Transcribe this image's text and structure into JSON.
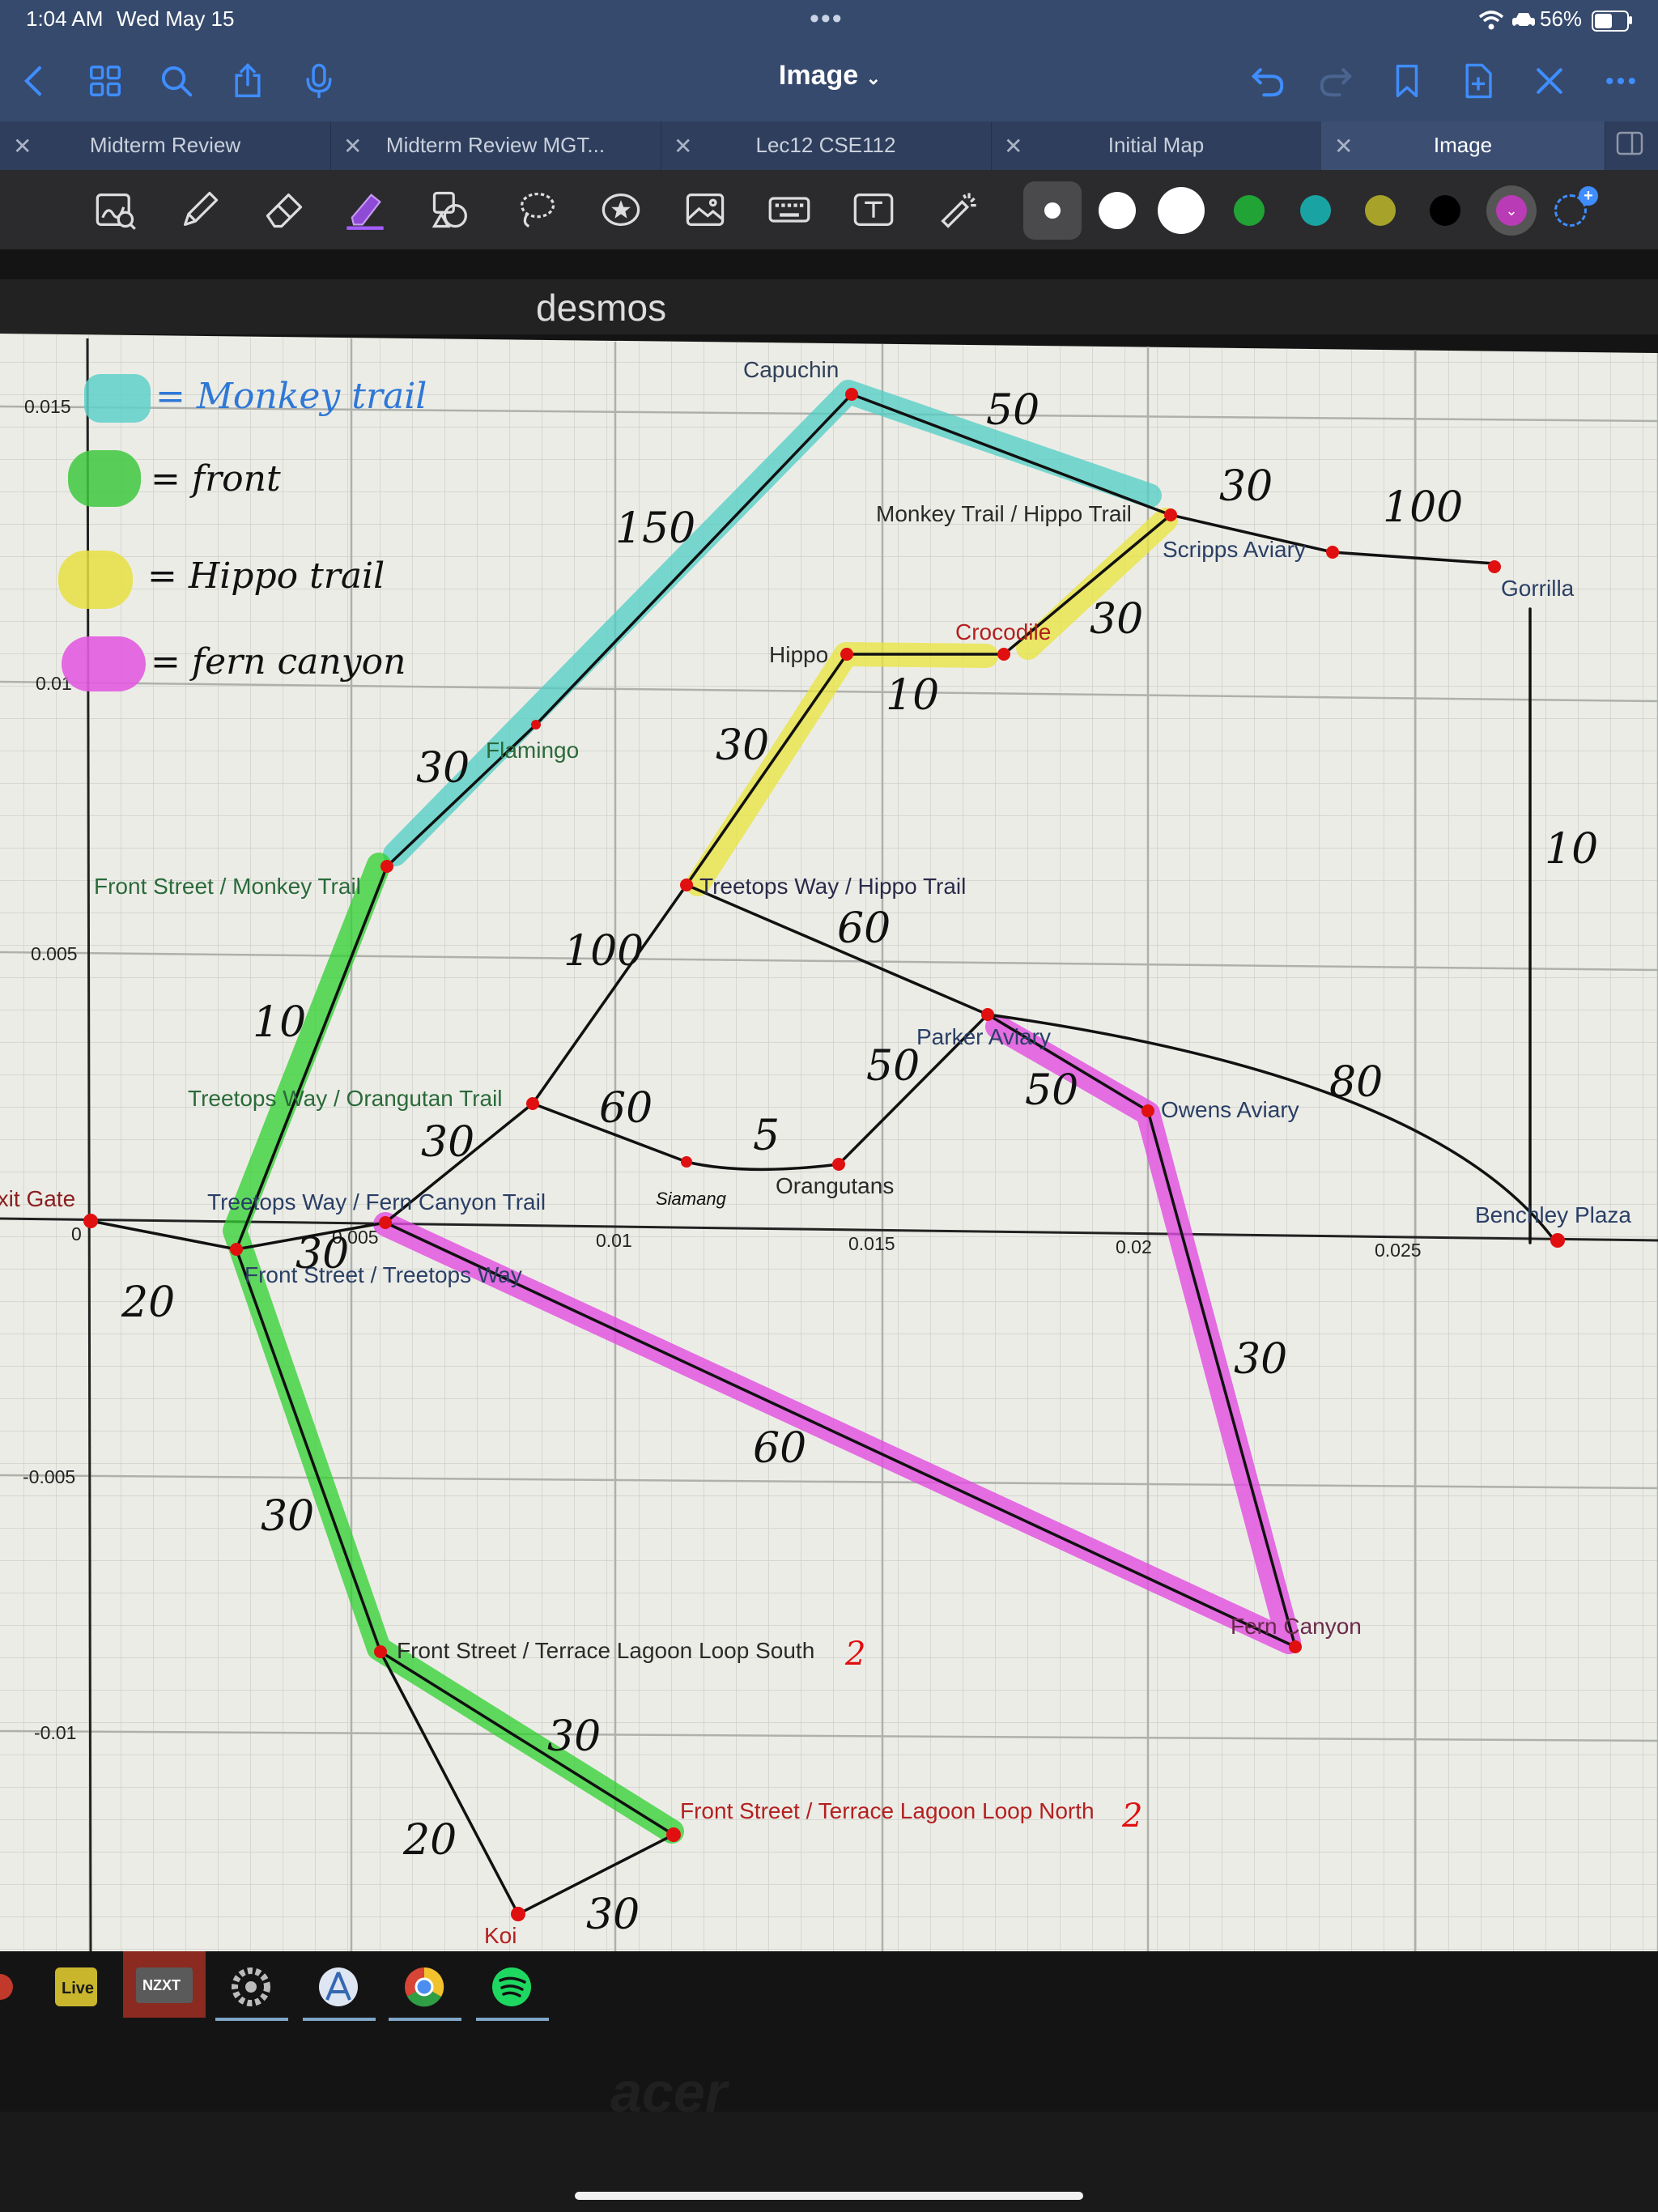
{
  "status_bar": {
    "time": "1:04 AM",
    "date": "Wed May 15",
    "battery": "56%",
    "battery_level": 0.56
  },
  "toolbar": {
    "title": "Image",
    "left_icons": [
      "back-icon",
      "grid-icon",
      "search-icon",
      "share-icon",
      "microphone-icon"
    ],
    "right_icons": [
      "undo-icon",
      "redo-icon",
      "bookmark-icon",
      "add-page-icon",
      "close-icon",
      "more-icon"
    ]
  },
  "tabs": [
    {
      "label": "Midterm Review",
      "active": false
    },
    {
      "label": "Midterm Review MGT...",
      "active": false
    },
    {
      "label": "Lec12 CSE112",
      "active": false
    },
    {
      "label": "Initial Map",
      "active": false
    },
    {
      "label": "Image",
      "active": true
    }
  ],
  "pen_toolbar": {
    "tools": [
      "zoom-box-icon",
      "pen-icon",
      "eraser-icon",
      "highlighter-icon",
      "shapes-icon",
      "lasso-icon",
      "sticker-icon",
      "image-icon",
      "keyboard-icon",
      "text-icon",
      "laser-pointer-icon"
    ],
    "colors": [
      "#ffffff",
      "#ffffff",
      "#ffffff",
      "#21a336",
      "#1aa3a3",
      "#a7a22a",
      "#000000",
      "#b93bb5"
    ],
    "selected_color": "#b93bb5"
  },
  "photo": {
    "app_logo": "desmos",
    "monitor_brand": "acer",
    "taskbar": [
      "Live",
      "NZXT"
    ],
    "legend": [
      {
        "color": "#5fd0c9",
        "text": "= Monkey trail"
      },
      {
        "color": "#3ec93e",
        "text": "= front"
      },
      {
        "color": "#e6e040",
        "text": "= Hippo trail"
      },
      {
        "color": "#e35ce0",
        "text": "= fern canyon"
      }
    ],
    "x_ticks": [
      "0",
      "0.005",
      "0.01",
      "0.015",
      "0.02",
      "0.025"
    ],
    "y_ticks": [
      "0.015",
      "0.01",
      "0.005",
      "0",
      "-0.005",
      "-0.01"
    ],
    "points": [
      {
        "label": "Capuchin",
        "x": 0.0146,
        "y": 0.0155
      },
      {
        "label": "Monkey Trail / Hippo Trail",
        "x": 0.0206,
        "y": 0.0135
      },
      {
        "label": "Scripps Aviary",
        "x": 0.0236,
        "y": 0.013
      },
      {
        "label": "Gorrilla",
        "x": 0.0267,
        "y": 0.0125
      },
      {
        "label": "Hippo",
        "x": 0.0146,
        "y": 0.0105
      },
      {
        "label": "Crocodile",
        "x": 0.0176,
        "y": 0.0105
      },
      {
        "label": "Flamingo",
        "x": 0.0085,
        "y": 0.0093
      },
      {
        "label": "Front Street / Monkey Trail",
        "x": 0.0057,
        "y": 0.0068
      },
      {
        "label": "Treetops Way / Hippo Trail",
        "x": 0.0115,
        "y": 0.0065
      },
      {
        "label": "Parker Aviary",
        "x": 0.017,
        "y": 0.004
      },
      {
        "label": "Owens Aviary",
        "x": 0.0202,
        "y": 0.0023
      },
      {
        "label": "Treetops Way / Orangutan Trail",
        "x": 0.0085,
        "y": 0.0023
      },
      {
        "label": "Siamang",
        "x": 0.0115,
        "y": 0.0012
      },
      {
        "label": "Orangutans",
        "x": 0.0143,
        "y": 0.0012
      },
      {
        "label": "Exit Gate",
        "x": 0.0,
        "y": 0.0003
      },
      {
        "label": "Treetops Way / Fern Canyon Trail",
        "x": 0.0057,
        "y": 0.0003
      },
      {
        "label": "Front Street / Treetops Way",
        "x": 0.0028,
        "y": -0.0003
      },
      {
        "label": "Benchley Plaza",
        "x": 0.0281,
        "y": -0.0001
      },
      {
        "label": "Fern Canyon",
        "x": 0.023,
        "y": -0.008
      },
      {
        "label": "Front Street / Terrace Lagoon Loop South",
        "x": 0.0057,
        "y": -0.008
      },
      {
        "label": "Front Street / Terrace Lagoon Loop North",
        "x": 0.0112,
        "y": -0.0115
      },
      {
        "label": "Koi",
        "x": 0.0082,
        "y": -0.013
      }
    ],
    "edge_weights": [
      "150",
      "50",
      "30",
      "100",
      "30",
      "10",
      "30",
      "30",
      "10",
      "100",
      "60",
      "50",
      "80",
      "60",
      "30",
      "5",
      "50",
      "10",
      "20",
      "10",
      "30",
      "60",
      "30",
      "30",
      "20",
      "30",
      "50"
    ],
    "note_marks": [
      "2",
      "2"
    ]
  }
}
